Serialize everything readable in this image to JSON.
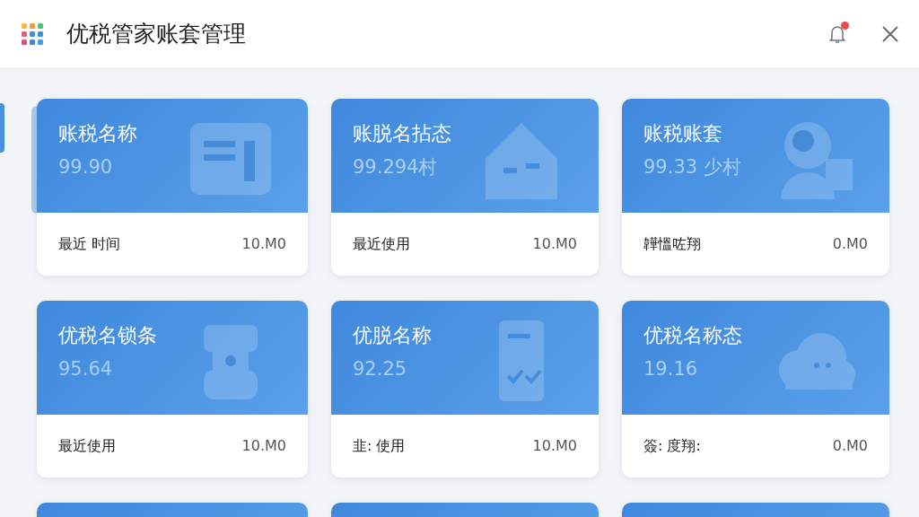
{
  "window": {
    "title": "优税管家账套管理"
  },
  "notifications": {
    "unread": true
  },
  "cards": [
    {
      "kind": "full",
      "title": "账税名称",
      "value": "99.90",
      "footer_label": "最近 时间",
      "footer_value": "10.M0"
    },
    {
      "kind": "full",
      "title": "账脱名拈态",
      "value": "99.294村",
      "footer_label": "最近使用",
      "footer_value": "10.M0"
    },
    {
      "kind": "full",
      "title": "账税账套",
      "value": "99.33 少村",
      "footer_label": "韡慍咗翔",
      "footer_value": "0.M0"
    },
    {
      "kind": "full",
      "title": "优税名锁条",
      "value": "95.64",
      "footer_label": "最近使用",
      "footer_value": "10.M0"
    },
    {
      "kind": "full",
      "title": "优脱名称",
      "value": "92.25",
      "footer_label": "韭: 使用",
      "footer_value": "10.M0"
    },
    {
      "kind": "full",
      "title": "优税名称态",
      "value": "19.16",
      "footer_label": "簽: 度翔:",
      "footer_value": "0.M0"
    },
    {
      "kind": "cut_off"
    },
    {
      "kind": "cut_off"
    },
    {
      "kind": "cut_off"
    }
  ]
}
